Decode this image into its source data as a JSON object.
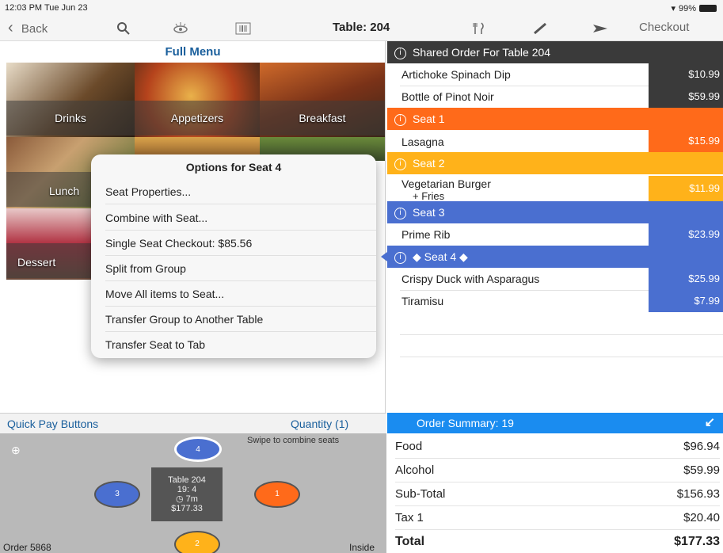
{
  "status": {
    "time": "12:03 PM  Tue Jun 23",
    "battery": "99%"
  },
  "nav": {
    "back_label": "Back",
    "title": "Table: 204",
    "checkout_label": "Checkout"
  },
  "menu": {
    "title": "Full Menu",
    "categories": [
      "Drinks",
      "Appetizers",
      "Breakfast",
      "Lunch",
      "Dessert"
    ]
  },
  "popover": {
    "title": "Options for Seat 4",
    "items": [
      "Seat Properties...",
      "Combine with Seat...",
      "Single Seat Checkout: $85.56",
      "Split from Group",
      "Move All items to Seat...",
      "Transfer Group to Another Table",
      "Transfer Seat to Tab"
    ]
  },
  "quickpay": {
    "left_label": "Quick Pay Buttons",
    "right_label": "Quantity (1)"
  },
  "seating": {
    "hint": "Swipe to combine seats",
    "order_label": "Order 5868",
    "location": "Inside",
    "table_lines": [
      "Table 204",
      "19: 4",
      "◷ 7m",
      "$177.33"
    ],
    "seats": [
      "4",
      "3",
      "1",
      "2"
    ]
  },
  "order": {
    "shared_header": "Shared Order For Table 204",
    "shared_items": [
      {
        "name": "Artichoke Spinach Dip",
        "price": "$10.99"
      },
      {
        "name": "Bottle of Pinot Noir",
        "price": "$59.99"
      }
    ],
    "seats": [
      {
        "label": "Seat 1",
        "items": [
          {
            "name": "Lasagna",
            "price": "$15.99"
          }
        ]
      },
      {
        "label": "Seat 2",
        "items": [
          {
            "name": "Vegetarian Burger",
            "sub": "+ Fries",
            "price": "$11.99"
          }
        ]
      },
      {
        "label": "Seat 3",
        "items": [
          {
            "name": "Prime Rib",
            "price": "$23.99"
          }
        ]
      },
      {
        "label": "◆  Seat 4 ◆",
        "items": [
          {
            "name": "Crispy Duck with Asparagus",
            "price": "$25.99"
          },
          {
            "name": "Tiramisu",
            "price": "$7.99"
          }
        ]
      }
    ]
  },
  "summary": {
    "header": "Order Summary: 19",
    "rows": [
      {
        "label": "Food",
        "value": "$96.94"
      },
      {
        "label": "Alcohol",
        "value": "$59.99"
      },
      {
        "label": "Sub-Total",
        "value": "$156.93"
      },
      {
        "label": "Tax 1",
        "value": "$20.40"
      },
      {
        "label": "Total",
        "value": "$177.33"
      }
    ]
  },
  "colors": {
    "shared": "#3a3a3a",
    "seat1": "#ff6a1a",
    "seat2": "#ffb21a",
    "seat3": "#4a6fd0",
    "seat4": "#4a6fd0",
    "summary": "#1a8cf0"
  }
}
